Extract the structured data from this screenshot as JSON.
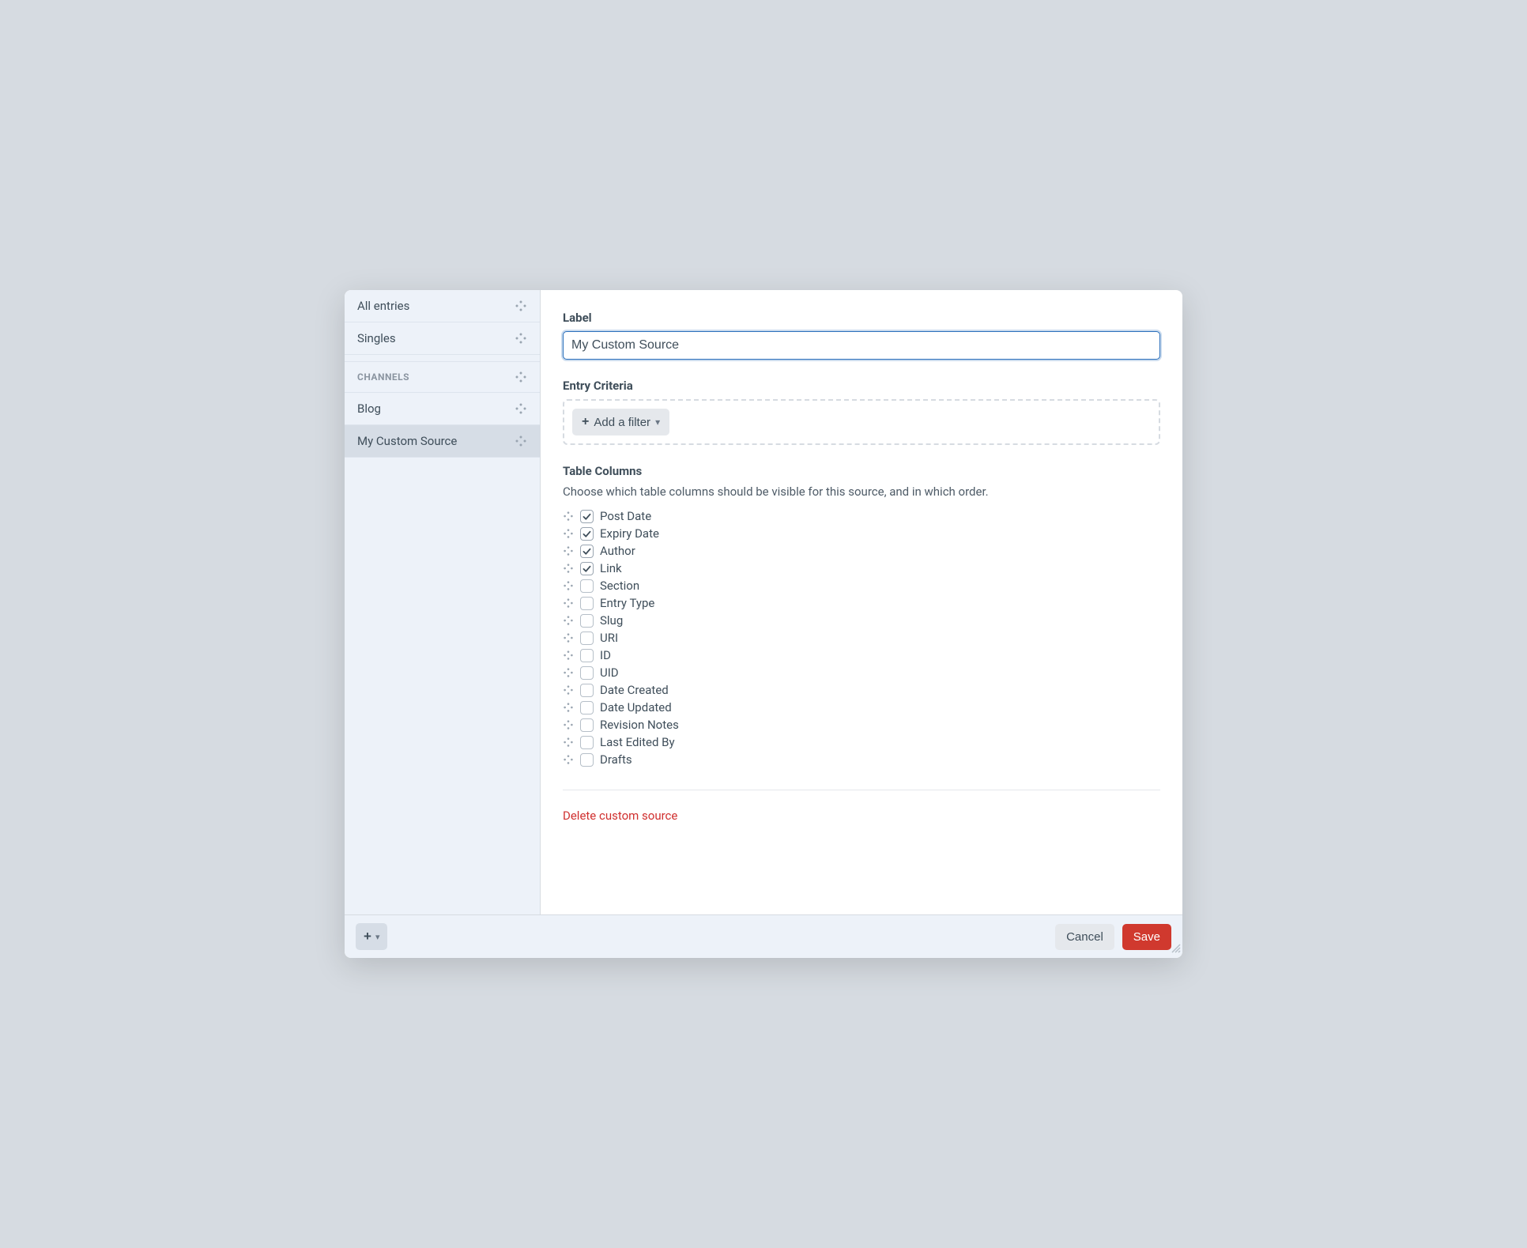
{
  "sidebar": {
    "items_top": [
      {
        "label": "All entries"
      },
      {
        "label": "Singles"
      }
    ],
    "heading": "CHANNELS",
    "channels": [
      {
        "label": "Blog",
        "selected": false
      },
      {
        "label": "My Custom Source",
        "selected": true
      }
    ]
  },
  "main": {
    "label_field": {
      "label": "Label",
      "value": "My Custom Source"
    },
    "criteria": {
      "label": "Entry Criteria",
      "add_filter": "Add a filter"
    },
    "columns": {
      "label": "Table Columns",
      "help": "Choose which table columns should be visible for this source, and in which order.",
      "items": [
        {
          "label": "Post Date",
          "checked": true
        },
        {
          "label": "Expiry Date",
          "checked": true
        },
        {
          "label": "Author",
          "checked": true
        },
        {
          "label": "Link",
          "checked": true
        },
        {
          "label": "Section",
          "checked": false
        },
        {
          "label": "Entry Type",
          "checked": false
        },
        {
          "label": "Slug",
          "checked": false
        },
        {
          "label": "URI",
          "checked": false
        },
        {
          "label": "ID",
          "checked": false
        },
        {
          "label": "UID",
          "checked": false
        },
        {
          "label": "Date Created",
          "checked": false
        },
        {
          "label": "Date Updated",
          "checked": false
        },
        {
          "label": "Revision Notes",
          "checked": false
        },
        {
          "label": "Last Edited By",
          "checked": false
        },
        {
          "label": "Drafts",
          "checked": false
        }
      ]
    },
    "delete_link": "Delete custom source"
  },
  "footer": {
    "cancel": "Cancel",
    "save": "Save"
  }
}
